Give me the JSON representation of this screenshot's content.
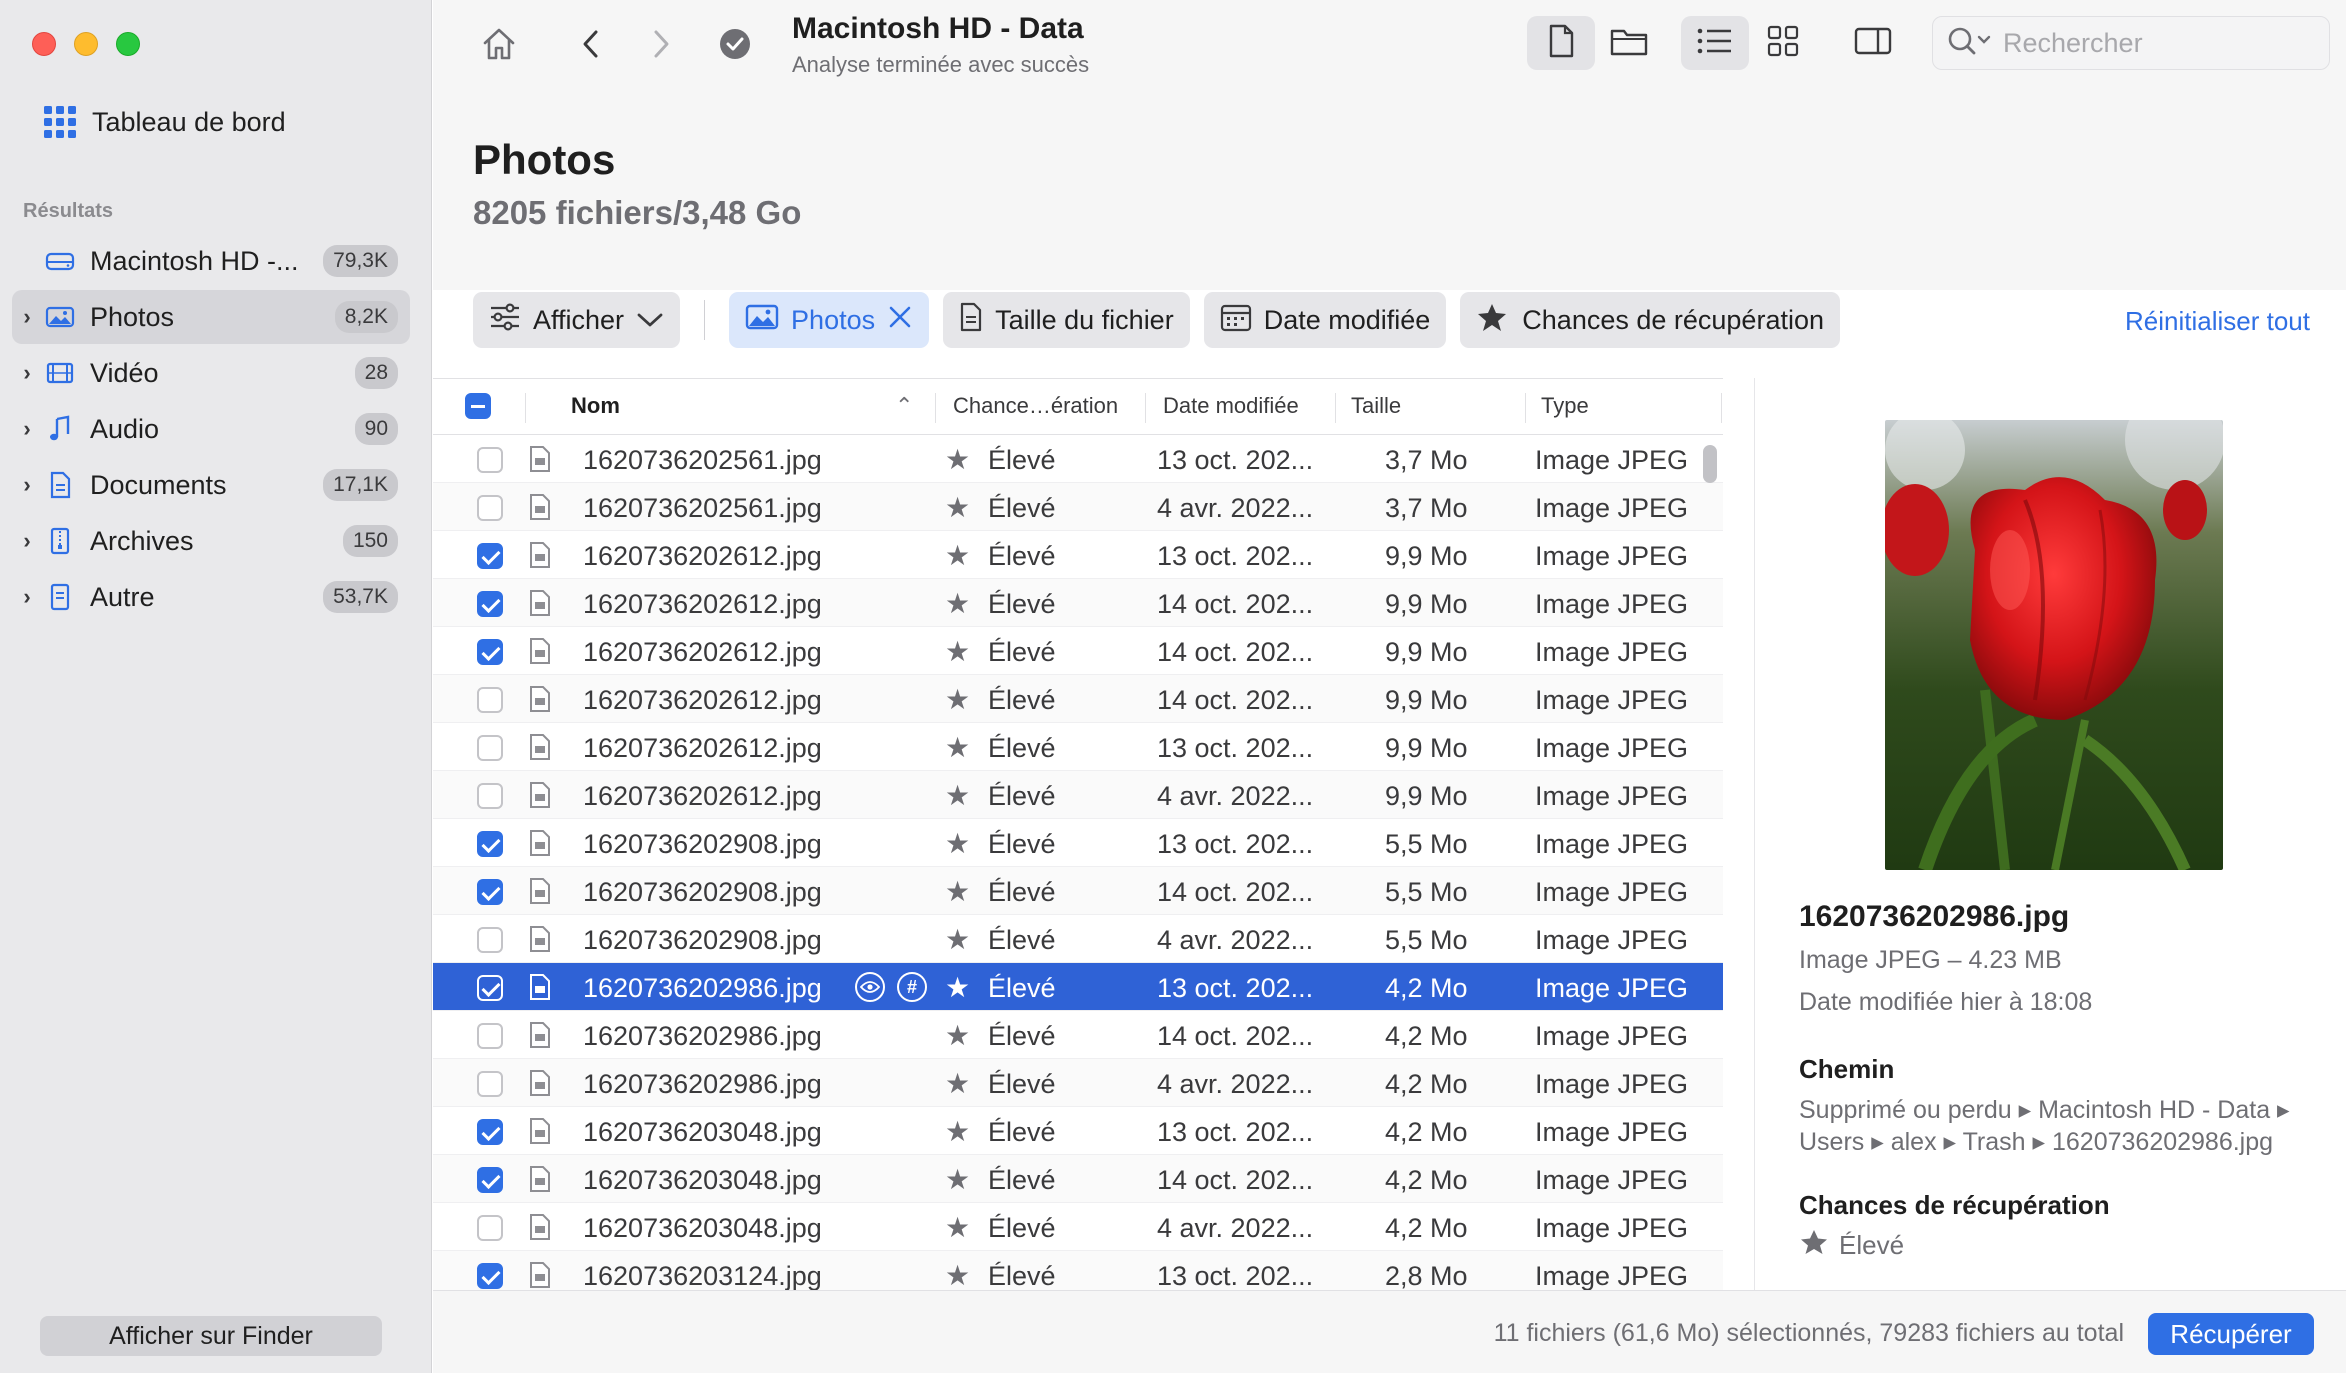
{
  "window": {
    "title": "Macintosh HD - Data",
    "subtitle": "Analyse terminée avec succès"
  },
  "sidebar": {
    "dashboard": "Tableau de bord",
    "section": "Résultats",
    "items": [
      {
        "label": "Macintosh HD -...",
        "count": "79,3K",
        "icon": "drive-icon",
        "chevron": false
      },
      {
        "label": "Photos",
        "count": "8,2K",
        "icon": "photo-icon",
        "chevron": true,
        "active": true
      },
      {
        "label": "Vidéo",
        "count": "28",
        "icon": "film-icon",
        "chevron": true
      },
      {
        "label": "Audio",
        "count": "90",
        "icon": "music-note-icon",
        "chevron": true
      },
      {
        "label": "Documents",
        "count": "17,1K",
        "icon": "document-icon",
        "chevron": true
      },
      {
        "label": "Archives",
        "count": "150",
        "icon": "archive-icon",
        "chevron": true
      },
      {
        "label": "Autre",
        "count": "53,7K",
        "icon": "file-icon",
        "chevron": true
      }
    ],
    "finder_button": "Afficher sur Finder"
  },
  "search": {
    "placeholder": "Rechercher"
  },
  "header": {
    "title": "Photos",
    "subtitle": "8205 fichiers/3,48 Go"
  },
  "filters": {
    "show": "Afficher",
    "photos": "Photos",
    "size": "Taille du fichier",
    "date": "Date modifiée",
    "chances": "Chances de récupération",
    "reset": "Réinitialiser tout"
  },
  "table": {
    "columns": {
      "name": "Nom",
      "chance": "Chance…ération",
      "date": "Date modifiée",
      "size": "Taille",
      "type": "Type"
    },
    "rows": [
      {
        "checked": false,
        "name": "1620736202561.jpg",
        "chance": "Élevé",
        "date": "13 oct. 202...",
        "size": "3,7 Mo",
        "type": "Image JPEG"
      },
      {
        "checked": false,
        "name": "1620736202561.jpg",
        "chance": "Élevé",
        "date": "4 avr. 2022...",
        "size": "3,7 Mo",
        "type": "Image JPEG"
      },
      {
        "checked": true,
        "name": "1620736202612.jpg",
        "chance": "Élevé",
        "date": "13 oct. 202...",
        "size": "9,9 Mo",
        "type": "Image JPEG"
      },
      {
        "checked": true,
        "name": "1620736202612.jpg",
        "chance": "Élevé",
        "date": "14 oct. 202...",
        "size": "9,9 Mo",
        "type": "Image JPEG"
      },
      {
        "checked": true,
        "name": "1620736202612.jpg",
        "chance": "Élevé",
        "date": "14 oct. 202...",
        "size": "9,9 Mo",
        "type": "Image JPEG"
      },
      {
        "checked": false,
        "name": "1620736202612.jpg",
        "chance": "Élevé",
        "date": "14 oct. 202...",
        "size": "9,9 Mo",
        "type": "Image JPEG"
      },
      {
        "checked": false,
        "name": "1620736202612.jpg",
        "chance": "Élevé",
        "date": "13 oct. 202...",
        "size": "9,9 Mo",
        "type": "Image JPEG"
      },
      {
        "checked": false,
        "name": "1620736202612.jpg",
        "chance": "Élevé",
        "date": "4 avr. 2022...",
        "size": "9,9 Mo",
        "type": "Image JPEG"
      },
      {
        "checked": true,
        "name": "1620736202908.jpg",
        "chance": "Élevé",
        "date": "13 oct. 202...",
        "size": "5,5 Mo",
        "type": "Image JPEG"
      },
      {
        "checked": true,
        "name": "1620736202908.jpg",
        "chance": "Élevé",
        "date": "14 oct. 202...",
        "size": "5,5 Mo",
        "type": "Image JPEG"
      },
      {
        "checked": false,
        "name": "1620736202908.jpg",
        "chance": "Élevé",
        "date": "4 avr. 2022...",
        "size": "5,5 Mo",
        "type": "Image JPEG"
      },
      {
        "checked": true,
        "selected": true,
        "name": "1620736202986.jpg",
        "chance": "Élevé",
        "date": "13 oct. 202...",
        "size": "4,2 Mo",
        "type": "Image JPEG"
      },
      {
        "checked": false,
        "name": "1620736202986.jpg",
        "chance": "Élevé",
        "date": "14 oct. 202...",
        "size": "4,2 Mo",
        "type": "Image JPEG"
      },
      {
        "checked": false,
        "name": "1620736202986.jpg",
        "chance": "Élevé",
        "date": "4 avr. 2022...",
        "size": "4,2 Mo",
        "type": "Image JPEG"
      },
      {
        "checked": true,
        "name": "1620736203048.jpg",
        "chance": "Élevé",
        "date": "13 oct. 202...",
        "size": "4,2 Mo",
        "type": "Image JPEG"
      },
      {
        "checked": true,
        "name": "1620736203048.jpg",
        "chance": "Élevé",
        "date": "14 oct. 202...",
        "size": "4,2 Mo",
        "type": "Image JPEG"
      },
      {
        "checked": false,
        "name": "1620736203048.jpg",
        "chance": "Élevé",
        "date": "4 avr. 2022...",
        "size": "4,2 Mo",
        "type": "Image JPEG"
      },
      {
        "checked": true,
        "name": "1620736203124.jpg",
        "chance": "Élevé",
        "date": "13 oct. 202...",
        "size": "2,8 Mo",
        "type": "Image JPEG"
      }
    ]
  },
  "preview": {
    "filename": "1620736202986.jpg",
    "meta": "Image JPEG – 4.23 MB",
    "date_label": "Date modifiée",
    "date_value": "hier à 18:08",
    "path_heading": "Chemin",
    "path": "Supprimé ou perdu ▸ Macintosh HD - Data ▸ Users ▸ alex ▸ Trash ▸ 1620736202986.jpg",
    "chance_heading": "Chances de récupération",
    "chance_value": "Élevé"
  },
  "footer": {
    "status": "11 fichiers (61,6 Mo) sélectionnés, 79283 fichiers au total",
    "recover": "Récupérer"
  },
  "colors": {
    "accent": "#2f6fe4",
    "selection": "#2f62d6",
    "sidebar_bg": "#e9e9eb"
  }
}
